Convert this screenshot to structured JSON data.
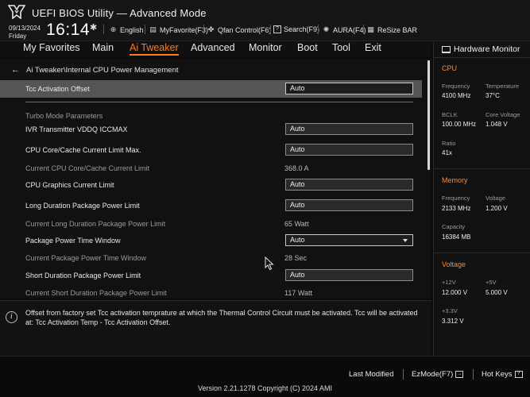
{
  "header": {
    "title": "UEFI BIOS Utility — Advanced Mode",
    "date": "09/13/2024",
    "day": "Friday",
    "time": "16:14",
    "tools": [
      {
        "label": "English",
        "icon": "globe-icon"
      },
      {
        "label": "MyFavorite(F3)",
        "icon": "favorite-icon"
      },
      {
        "label": "Qfan Control(F6)",
        "icon": "fan-icon"
      },
      {
        "label": "Search(F9)",
        "icon": "search-icon"
      },
      {
        "label": "AURA(F4)",
        "icon": "aura-icon"
      },
      {
        "label": "ReSize BAR",
        "icon": "resize-bar-icon"
      }
    ]
  },
  "menu": {
    "items": [
      "My Favorites",
      "Main",
      "Ai Tweaker",
      "Advanced",
      "Monitor",
      "Boot",
      "Tool",
      "Exit"
    ],
    "active": "Ai Tweaker"
  },
  "breadcrumb": "Ai Tweaker\\Internal CPU Power Management",
  "settings": {
    "tcc": {
      "label": "Tcc Activation Offset",
      "value": "Auto"
    },
    "turbo_header": "Turbo Mode Parameters",
    "rows": [
      {
        "label": "IVR Transmitter VDDQ ICCMAX",
        "value": "Auto"
      },
      {
        "label": "CPU Core/Cache Current Limit Max.",
        "value": "Auto"
      },
      {
        "label": "Current CPU Core/Cache Current Limit",
        "value": "368.0 A"
      },
      {
        "label": "CPU Graphics Current Limit",
        "value": "Auto"
      },
      {
        "label": "Long Duration Package Power Limit",
        "value": "Auto"
      },
      {
        "label": "Current Long Duration Package Power Limit",
        "value": "65 Watt"
      },
      {
        "label": "Package Power Time Window",
        "value": "Auto"
      },
      {
        "label": "Current Package Power Time Window",
        "value": "28 Sec"
      },
      {
        "label": "Short Duration Package Power Limit",
        "value": "Auto"
      },
      {
        "label": "Current Short Duration Package Power Limit",
        "value": "117 Watt"
      }
    ]
  },
  "help_text": "Offset from factory set Tcc activation temprature at which the Thermal Control Circuit must be activated. Tcc will be activated at: Tcc Activation Temp - Tcc Activation Offset.",
  "hw_monitor": {
    "title": "Hardware Monitor",
    "cpu": {
      "section": "CPU",
      "frequency_label": "Frequency",
      "frequency": "4100 MHz",
      "temperature_label": "Temperature",
      "temperature": "37°C",
      "bclk_label": "BCLK",
      "bclk": "100.00 MHz",
      "core_voltage_label": "Core Voltage",
      "core_voltage": "1.048 V",
      "ratio_label": "Ratio",
      "ratio": "41x"
    },
    "memory": {
      "section": "Memory",
      "frequency_label": "Frequency",
      "frequency": "2133 MHz",
      "voltage_label": "Voltage",
      "voltage": "1.200 V",
      "capacity_label": "Capacity",
      "capacity": "16384 MB"
    },
    "voltage": {
      "section": "Voltage",
      "v12_label": "+12V",
      "v12": "12.000 V",
      "v5_label": "+5V",
      "v5": "5.000 V",
      "v33_label": "+3.3V",
      "v33": "3.312 V"
    }
  },
  "footer": {
    "last_modified": "Last Modified",
    "ezmode": "EzMode(F7)",
    "hotkeys": "Hot Keys",
    "hotkeys_icon": "?",
    "copyright": "Version 2.21.1278 Copyright (C) 2024 AMI"
  },
  "colors": {
    "accent": "#ff7a1a",
    "selected_row": "#555555",
    "background": "#111111"
  }
}
